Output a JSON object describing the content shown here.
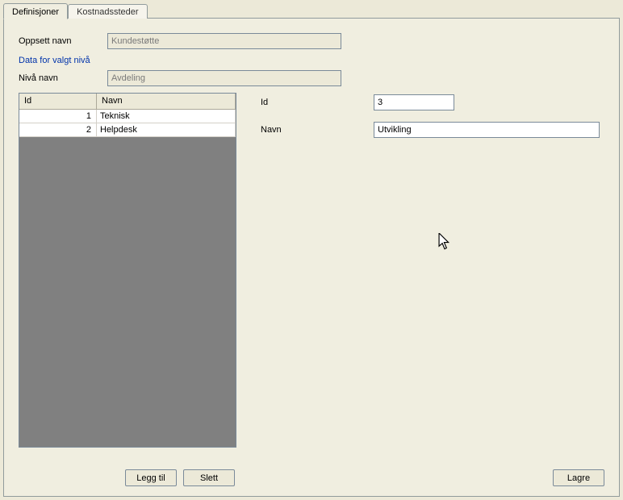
{
  "tabs": {
    "active": "Definisjoner",
    "inactive": "Kostnadssteder"
  },
  "form": {
    "oppsett_label": "Oppsett navn",
    "oppsett_value": "Kundestøtte",
    "section": "Data for valgt nivå",
    "niva_label": "Nivå navn",
    "niva_value": "Avdeling"
  },
  "grid": {
    "header_id": "Id",
    "header_name": "Navn",
    "rows": [
      {
        "id": "1",
        "name": "Teknisk"
      },
      {
        "id": "2",
        "name": "Helpdesk"
      }
    ]
  },
  "detail": {
    "id_label": "Id",
    "id_value": "3",
    "name_label": "Navn",
    "name_value": "Utvikling"
  },
  "buttons": {
    "add": "Legg til",
    "delete": "Slett",
    "save": "Lagre"
  }
}
